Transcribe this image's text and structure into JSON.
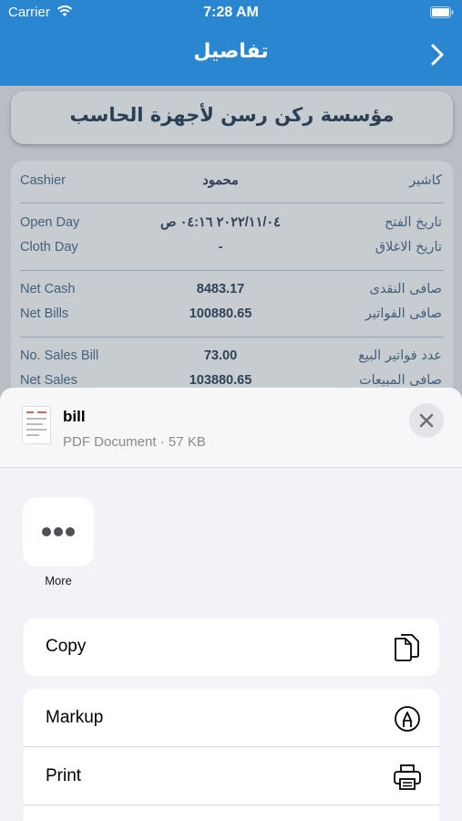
{
  "status_bar": {
    "carrier": "Carrier",
    "time": "7:28 AM"
  },
  "nav": {
    "title": "تفاصيل"
  },
  "company": {
    "name": "مؤسسة ركن رسن لأجهزة الحاسب"
  },
  "details": {
    "rows": [
      {
        "en": "Cashier",
        "value": "محمود",
        "ar": "كاشير"
      },
      {
        "en": "Open Day",
        "value": "٢٠٢٢/١١/٠٤ ٠٤:١٦ ص",
        "ar": "تاريخ الفتح"
      },
      {
        "en": "Cloth Day",
        "value": "-",
        "ar": "تاريخ الاغلاق"
      },
      {
        "en": "Net Cash",
        "value": "8483.17",
        "ar": "صافى النقدى"
      },
      {
        "en": "Net Bills",
        "value": "100880.65",
        "ar": "صافى الفواتير"
      },
      {
        "en": "No. Sales Bill",
        "value": "73.00",
        "ar": "عدد فواتير البيع"
      },
      {
        "en": "Net Sales",
        "value": "103880.65",
        "ar": "صافى المبيعات"
      }
    ]
  },
  "share_sheet": {
    "file_name": "bill",
    "file_meta": "PDF Document · 57 KB",
    "more_label": "More",
    "actions": {
      "copy": "Copy",
      "markup": "Markup",
      "print": "Print"
    }
  },
  "colors": {
    "header": "#2a86d1",
    "card": "#c7ccd1",
    "sheet": "#f2f2f7"
  }
}
